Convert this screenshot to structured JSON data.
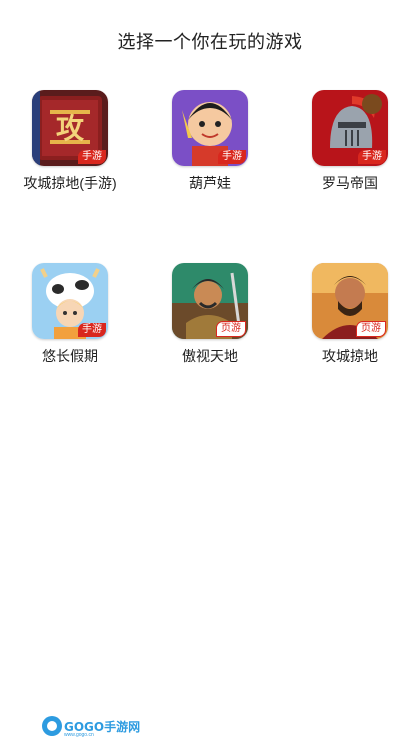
{
  "header": {
    "title": "选择一个你在玩的游戏"
  },
  "games": [
    {
      "name": "攻城掠地(手游)",
      "badge": "手游",
      "badge_type": "mobile"
    },
    {
      "name": "葫芦娃",
      "badge": "手游",
      "badge_type": "mobile"
    },
    {
      "name": "罗马帝国",
      "badge": "手游",
      "badge_type": "mobile"
    },
    {
      "name": "悠长假期",
      "badge": "手游",
      "badge_type": "mobile"
    },
    {
      "name": "傲视天地",
      "badge": "页游",
      "badge_type": "web"
    },
    {
      "name": "攻城掠地",
      "badge": "页游",
      "badge_type": "web"
    }
  ],
  "footer": {
    "logo_text": "GOGO手游网",
    "logo_sub": "www.gogo.cn"
  },
  "colors": {
    "badge_red": "#d9271e",
    "logo_blue": "#2d9be0"
  }
}
